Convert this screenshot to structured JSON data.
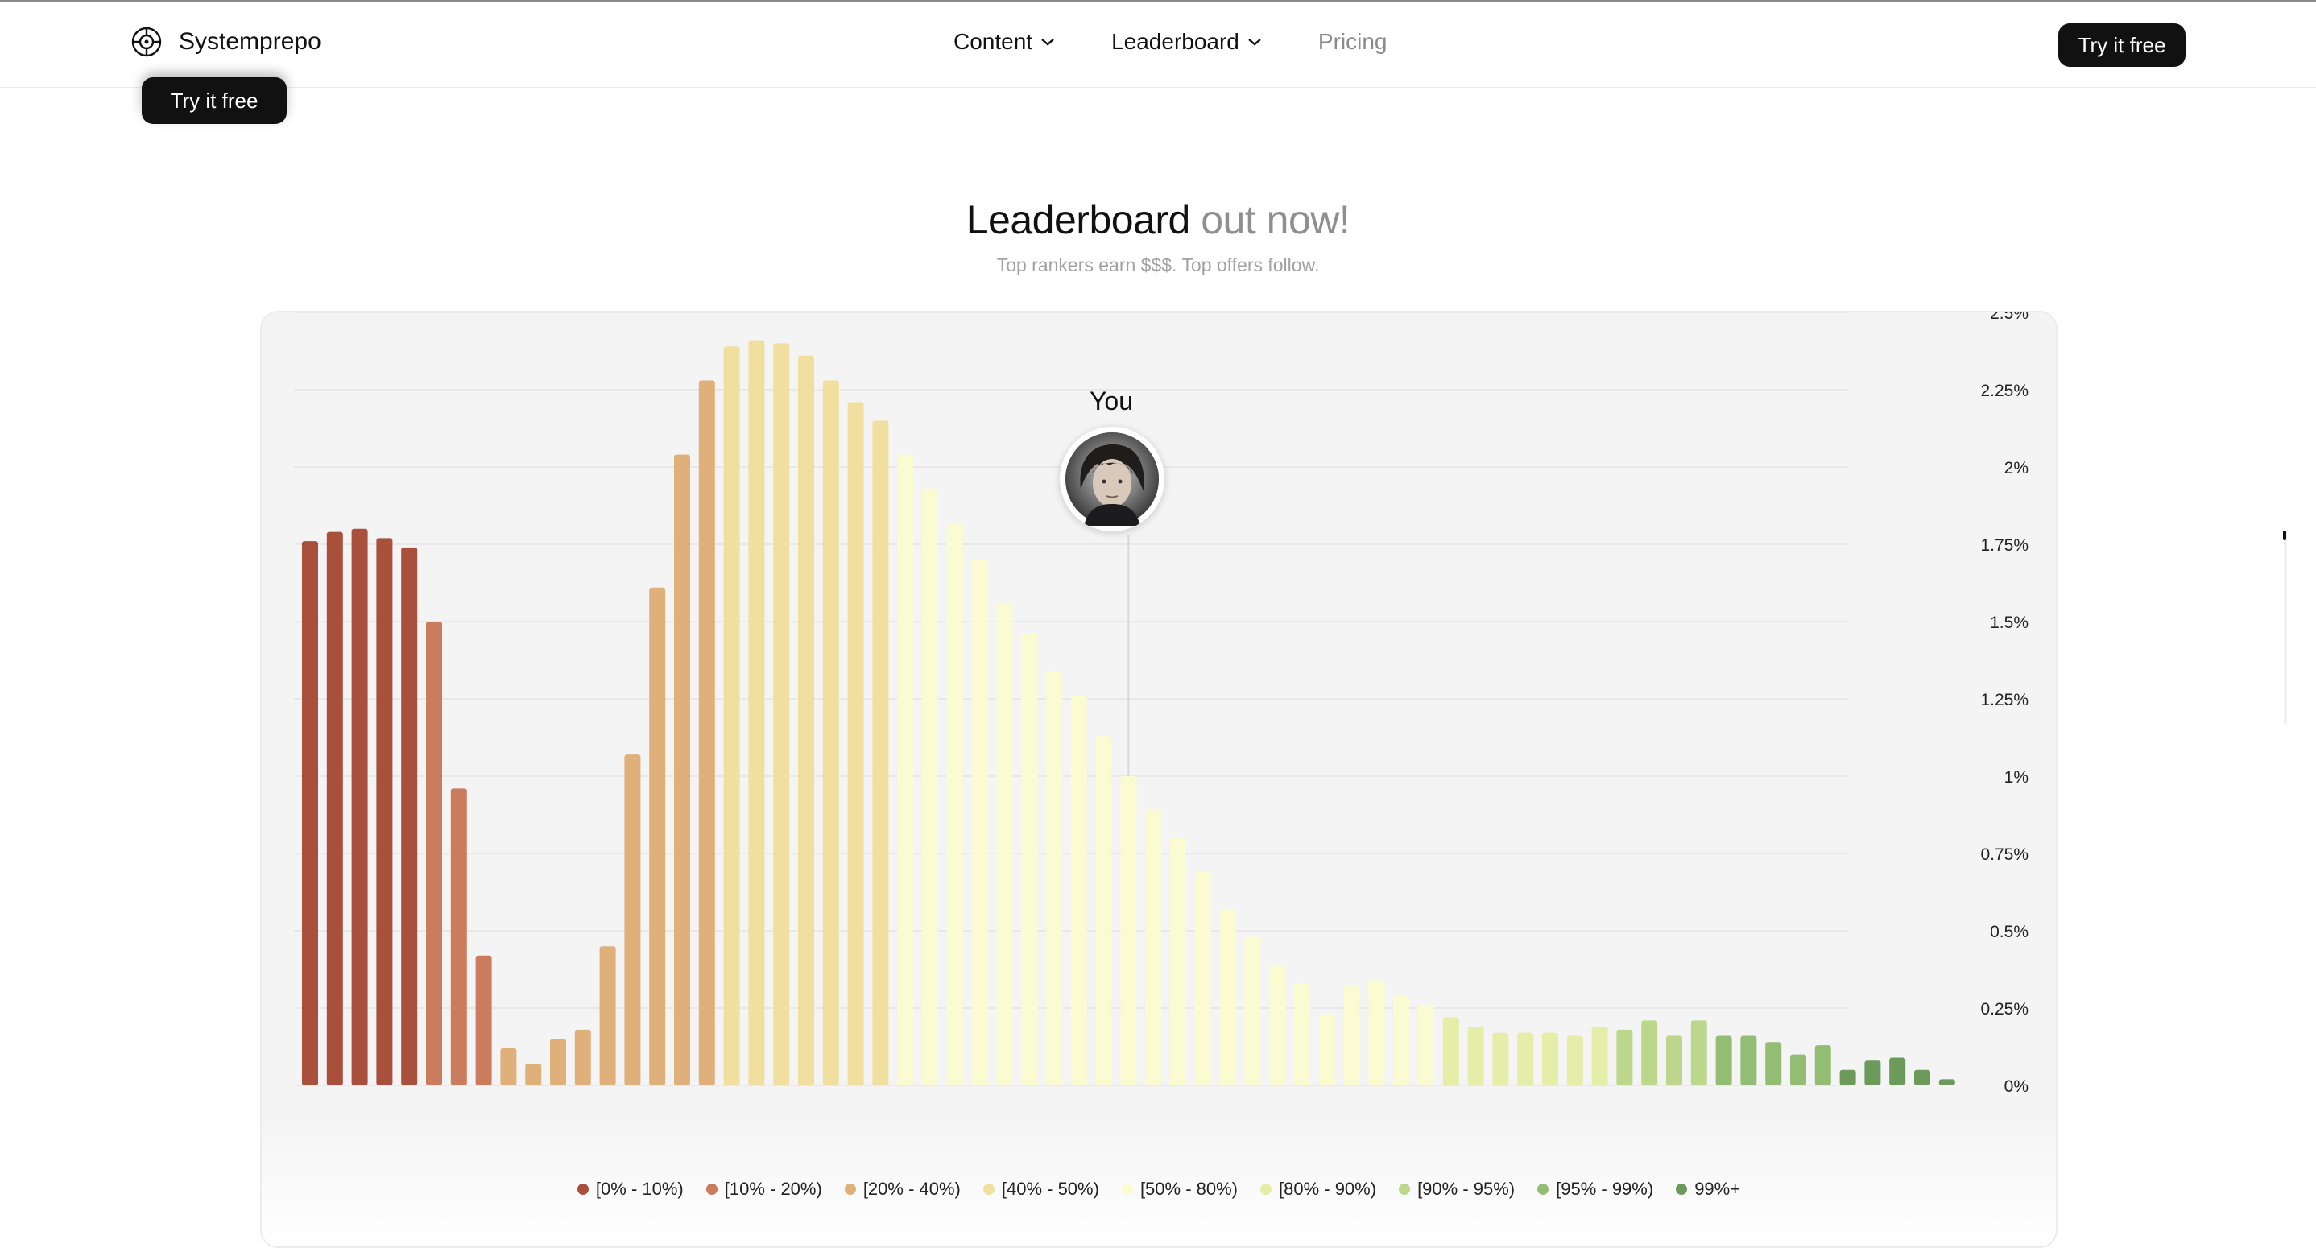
{
  "nav": {
    "brand": "Systemprepo",
    "brand_icon": "crosshair-icon",
    "links": [
      {
        "label": "Content",
        "has_dropdown": true
      },
      {
        "label": "Leaderboard",
        "has_dropdown": true
      },
      {
        "label": "Pricing",
        "has_dropdown": false
      }
    ],
    "cta_label": "Try it free"
  },
  "ghost_cta_label": "Try it free",
  "section": {
    "title_main": "Leaderboard",
    "title_soft": "out now!",
    "subtitle": "Top rankers earn $$$. Top offers follow."
  },
  "marker": {
    "label": "You",
    "icon": "avatar-portrait-icon"
  },
  "colors": {
    "p0_10": "#a9503c",
    "p10_20": "#cb7c5c",
    "p20_40": "#dfb07a",
    "p40_50": "#f0df9f",
    "p50_80": "#fbfbd2",
    "p80_90": "#e6eda8",
    "p90_95": "#bcd68b",
    "p95_99": "#93bd73",
    "p99": "#6c9a5b"
  },
  "chart_data": {
    "type": "bar",
    "y_ticks": [
      "0%",
      "0.25%",
      "0.5%",
      "0.75%",
      "1%",
      "1.25%",
      "1.5%",
      "1.75%",
      "2%",
      "2.25%",
      "2.5%"
    ],
    "ylim": [
      0,
      2.5
    ],
    "grid": true,
    "y_axis_side": "right",
    "legend_position": "bottom",
    "you_marker_bar_index": 33,
    "legend": [
      {
        "label": "[0% - 10%)",
        "color": "#a9503c"
      },
      {
        "label": "[10% - 20%)",
        "color": "#cb7c5c"
      },
      {
        "label": "[20% - 40%)",
        "color": "#dfb07a"
      },
      {
        "label": "[40% - 50%)",
        "color": "#f0df9f"
      },
      {
        "label": "[50% - 80%)",
        "color": "#fbfbd2"
      },
      {
        "label": "[80% - 90%)",
        "color": "#e6eda8"
      },
      {
        "label": "[90% - 95%)",
        "color": "#bcd68b"
      },
      {
        "label": "[95% - 99%)",
        "color": "#93bd73"
      },
      {
        "label": "99%+",
        "color": "#6c9a5b"
      }
    ],
    "series": [
      {
        "group": "[0% - 10%)",
        "values": [
          1.76,
          1.79,
          1.8,
          1.77,
          1.74
        ]
      },
      {
        "group": "[10% - 20%)",
        "values": [
          1.5,
          0.96,
          0.42
        ]
      },
      {
        "group": "[20% - 40%)",
        "values": [
          0.12,
          0.07,
          0.15,
          0.18,
          0.45,
          1.07,
          1.61,
          2.04,
          2.28
        ]
      },
      {
        "group": "[40% - 50%)",
        "values": [
          2.39,
          2.41,
          2.4,
          2.36,
          2.28,
          2.21,
          2.15
        ]
      },
      {
        "group": "[50% - 80%)",
        "values": [
          2.04,
          1.93,
          1.82,
          1.7,
          1.56,
          1.46,
          1.34,
          1.26,
          1.13,
          1.0,
          0.89,
          0.8,
          0.69,
          0.57,
          0.48,
          0.39,
          0.33,
          0.23,
          0.32,
          0.34,
          0.29,
          0.26
        ]
      },
      {
        "group": "[80% - 90%)",
        "values": [
          0.22,
          0.19,
          0.17,
          0.17,
          0.17,
          0.16,
          0.19
        ]
      },
      {
        "group": "[90% - 95%)",
        "values": [
          0.18,
          0.21,
          0.16,
          0.21
        ]
      },
      {
        "group": "[95% - 99%)",
        "values": [
          0.16,
          0.16,
          0.14,
          0.1,
          0.13
        ]
      },
      {
        "group": "99%+",
        "values": [
          0.05,
          0.08,
          0.09,
          0.05,
          0.02
        ]
      }
    ]
  }
}
